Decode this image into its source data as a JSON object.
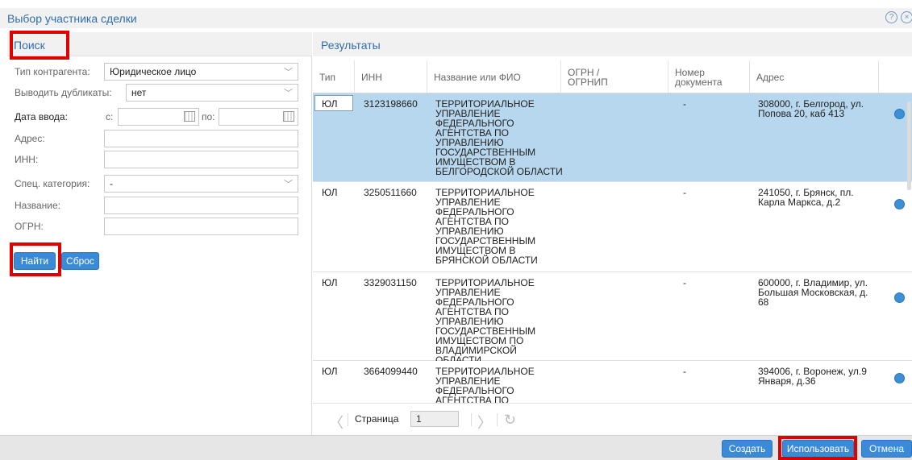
{
  "window": {
    "title": "Выбор участника сделки",
    "help_icon": "?",
    "close_icon": "×"
  },
  "search": {
    "header": "Поиск",
    "contractor_type_label": "Тип контрагента:",
    "contractor_type_value": "Юридическое лицо",
    "duplicates_label": "Выводить дубликаты:",
    "duplicates_value": "нет",
    "date_label": "Дата ввода:",
    "date_from_label": "с:",
    "date_to_label": "по:",
    "date_from_value": "",
    "date_to_value": "",
    "address_label": "Адрес:",
    "address_value": "",
    "inn_label": "ИНН:",
    "inn_value": "",
    "category_label": "Спец. категория:",
    "category_value": "-",
    "name_label": "Название:",
    "name_value": "",
    "ogrn_label": "ОГРН:",
    "ogrn_value": "",
    "find_button": "Найти",
    "reset_button": "Сброс"
  },
  "results": {
    "header": "Результаты",
    "columns": {
      "type": "Тип",
      "inn": "ИНН",
      "name": "Название или ФИО",
      "ogrn": "ОГРН / ОГРНИП",
      "doc": "Номер документа",
      "address": "Адрес"
    },
    "rows": [
      {
        "type": "ЮЛ",
        "inn": "3123198660",
        "name": "ТЕРРИТОРИАЛЬНОЕ УПРАВЛЕНИЕ ФЕДЕРАЛЬНОГО АГЕНТСТВА ПО УПРАВЛЕНИЮ ГОСУДАРСТВЕННЫМ ИМУЩЕСТВОМ В БЕЛГОРОДСКОЙ ОБЛАСТИ",
        "ogrn": "",
        "doc": "-",
        "address": "308000, г. Белгород, ул. Попова 20, каб 413"
      },
      {
        "type": "ЮЛ",
        "inn": "3250511660",
        "name": "ТЕРРИТОРИАЛЬНОЕ УПРАВЛЕНИЕ ФЕДЕРАЛЬНОГО АГЕНТСТВА ПО УПРАВЛЕНИЮ ГОСУДАРСТВЕННЫМ ИМУЩЕСТВОМ В БРЯНСКОЙ ОБЛАСТИ",
        "ogrn": "",
        "doc": "-",
        "address": "241050, г. Брянск, пл. Карла Маркса, д.2"
      },
      {
        "type": "ЮЛ",
        "inn": "3329031150",
        "name": "ТЕРРИТОРИАЛЬНОЕ УПРАВЛЕНИЕ ФЕДЕРАЛЬНОГО АГЕНТСТВА ПО УПРАВЛЕНИЮ ГОСУДАРСТВЕННЫМ ИМУЩЕСТВОМ ПО ВЛАДИМИРСКОЙ ОБЛАСТИ",
        "ogrn": "",
        "doc": "-",
        "address": "600000, г. Владимир, ул. Большая Московская, д. 68"
      },
      {
        "type": "ЮЛ",
        "inn": "3664099440",
        "name": "ТЕРРИТОРИАЛЬНОЕ УПРАВЛЕНИЕ ФЕДЕРАЛЬНОГО АГЕНТСТВА ПО",
        "ogrn": "",
        "doc": "-",
        "address": "394006, г. Воронеж, ул.9 Января, д.36"
      }
    ],
    "pager": {
      "page_label": "Страница",
      "page_value": "1",
      "prev_icon": "〈",
      "next_icon": "〉",
      "refresh_icon": "↻"
    }
  },
  "footer": {
    "create_button": "Создать",
    "use_button": "Использовать",
    "cancel_button": "Отмена"
  }
}
